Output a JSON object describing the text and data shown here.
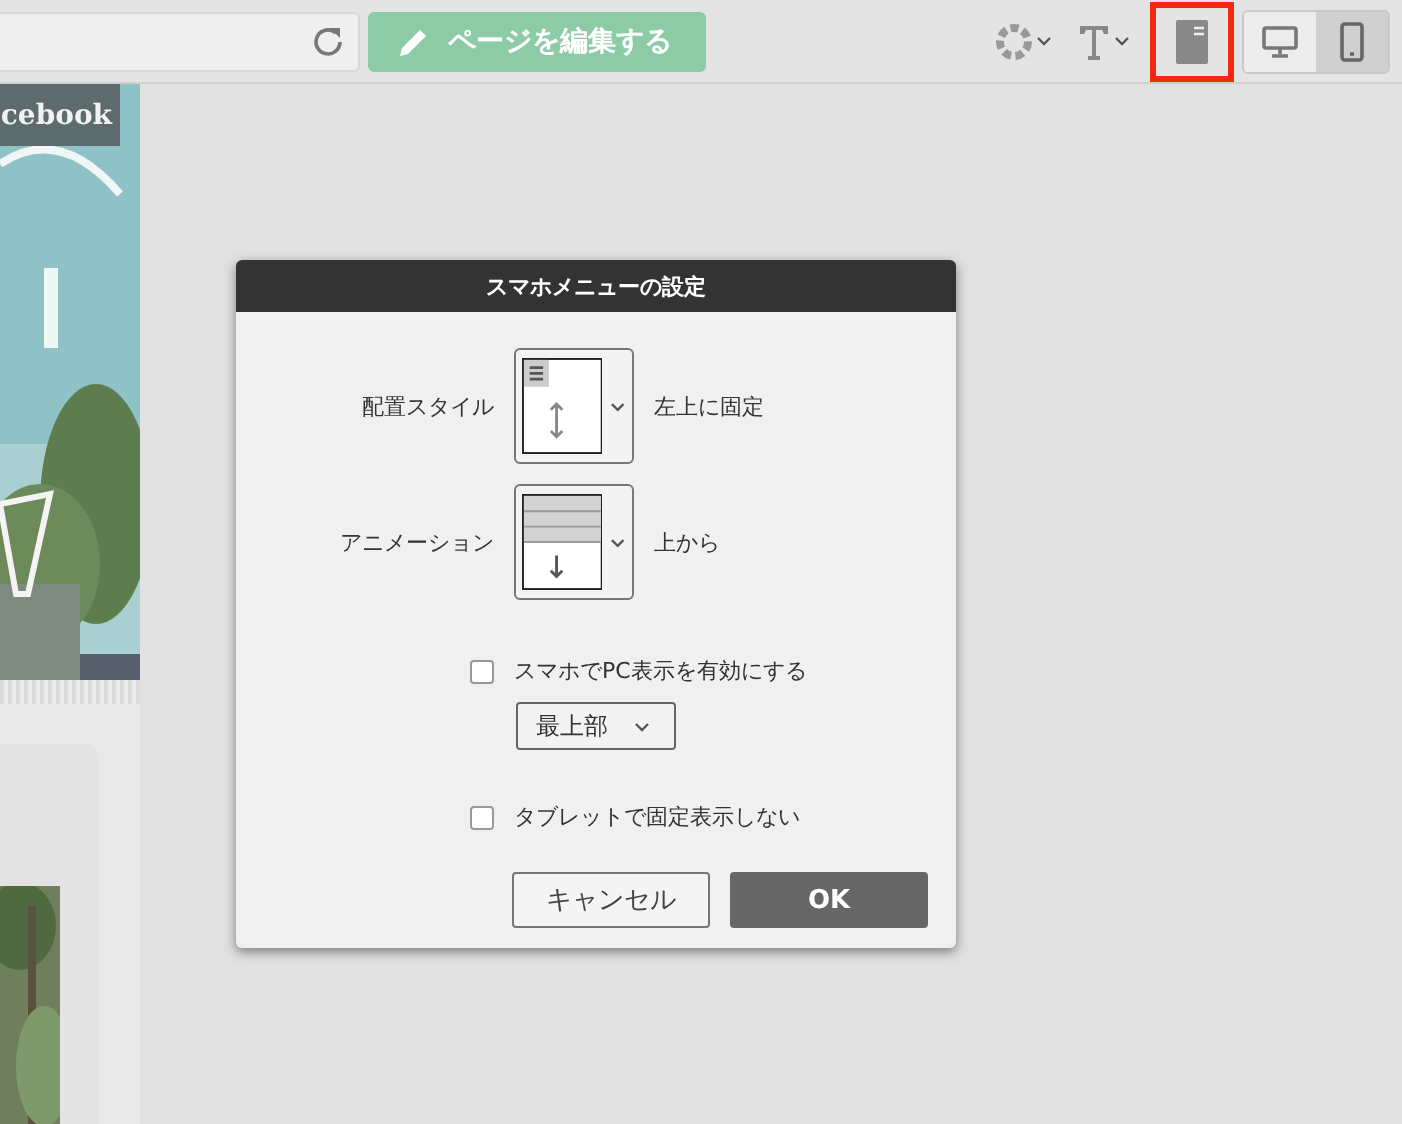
{
  "toolbar": {
    "edit_button": "ページを編集する",
    "menu_button": {
      "highlighted": true
    },
    "devices": [
      {
        "kind": "desktop",
        "selected": false
      },
      {
        "kind": "phone",
        "selected": true
      }
    ]
  },
  "preview": {
    "banner_label": "cebook"
  },
  "dialog": {
    "title": "スマホメニューの設定",
    "settings": [
      {
        "label": "配置スタイル",
        "kind": "position",
        "value": "左上に固定"
      },
      {
        "label": "アニメーション",
        "kind": "animation",
        "value": "上から"
      }
    ],
    "options": [
      {
        "label": "スマホでPC表示を有効にする",
        "checked": false,
        "select": "最上部"
      },
      {
        "label": "タブレットで固定表示しない",
        "checked": false
      }
    ],
    "buttons": [
      {
        "label": "キャンセル",
        "kind": "secondary"
      },
      {
        "label": "OK",
        "kind": "primary"
      }
    ]
  }
}
